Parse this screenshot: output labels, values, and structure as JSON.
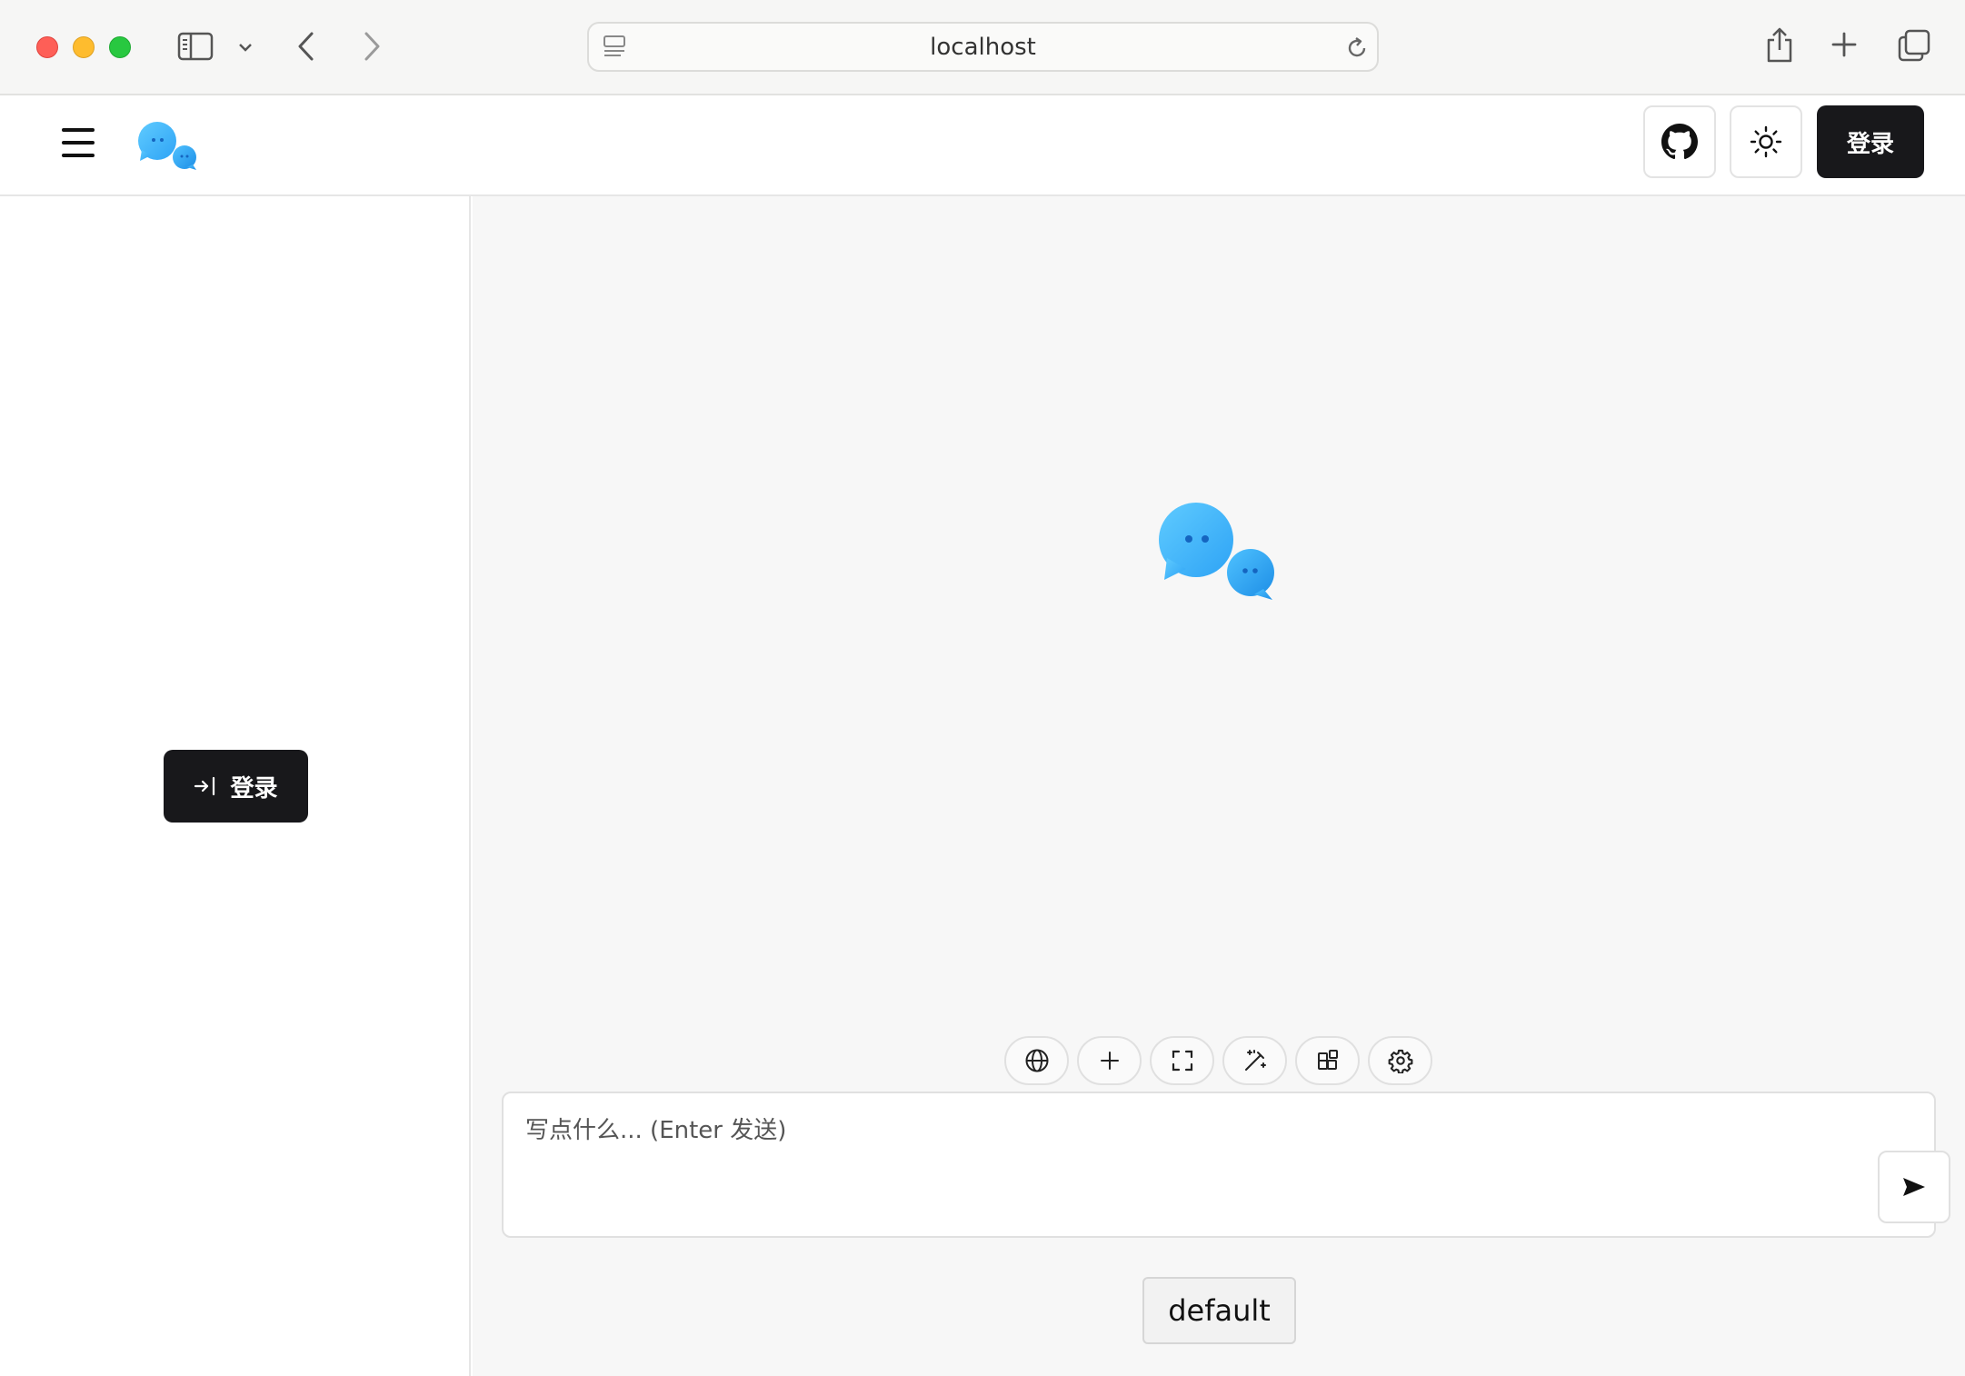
{
  "browser": {
    "url": "localhost",
    "traffic_lights": {
      "close": "#fe5f57",
      "minimize": "#febc2e",
      "zoom": "#28c840"
    },
    "icons": [
      "sidebar-toggle-icon",
      "chevron-down-icon",
      "back-icon",
      "forward-icon",
      "page-icon",
      "reload-icon",
      "share-icon",
      "new-tab-icon",
      "tabs-overview-icon"
    ]
  },
  "header": {
    "icons": [
      "menu-icon",
      "chat-logo",
      "github-icon",
      "sun-icon"
    ],
    "login_label": "登录",
    "accent": "#18181b"
  },
  "sidebar": {
    "login_label": "登录",
    "login_icon": "sign-in-icon"
  },
  "main": {
    "logo_colors": [
      "#3ab4f9",
      "#1e8ee6"
    ],
    "toolbar": [
      {
        "name": "web-search",
        "icon": "globe-icon"
      },
      {
        "name": "new-chat",
        "icon": "plus-icon"
      },
      {
        "name": "fullscreen",
        "icon": "expand-icon"
      },
      {
        "name": "prompt-magic",
        "icon": "magic-wand-icon"
      },
      {
        "name": "plugins",
        "icon": "grid-icon"
      },
      {
        "name": "settings",
        "icon": "gear-icon"
      }
    ],
    "input": {
      "placeholder": "写点什么... (Enter 发送)",
      "value": ""
    },
    "send_icon": "send-icon",
    "model_label": "default"
  }
}
